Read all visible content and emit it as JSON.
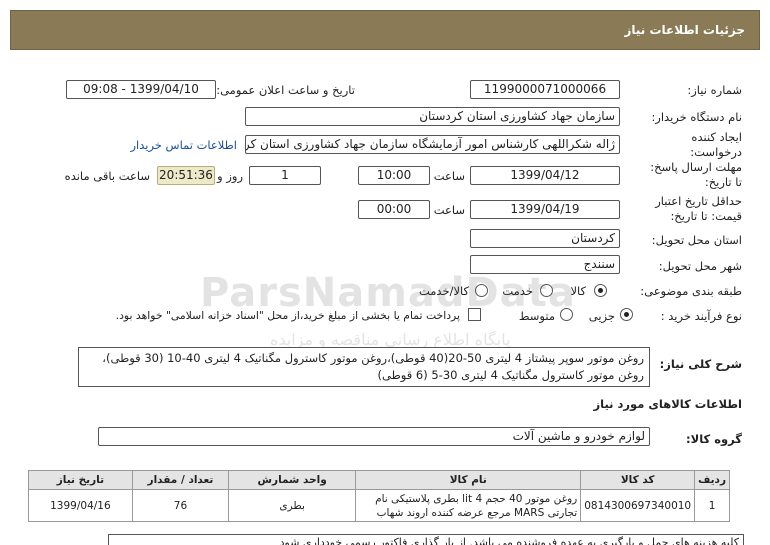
{
  "header": {
    "title": "جزئیات اطلاعات نیاز"
  },
  "form": {
    "need_number_label": "شماره نیاز:",
    "need_number": "1199000071000066",
    "announce_label": "تاریخ و ساعت اعلان عمومی:",
    "announce_value": "1399/04/10 - 09:08",
    "buyer_org_label": "نام دستگاه خریدار:",
    "buyer_org": "سازمان جهاد کشاورزی استان کردستان",
    "creator_label": "ایجاد کننده درخواست:",
    "creator": "ژاله شکراللهی کارشناس امور آزمایشگاه سازمان جهاد کشاورزی استان کردستان",
    "contact_link": "اطلاعات تماس خریدار",
    "reply_deadline_label": "مهلت ارسال پاسخ: تا تاریخ:",
    "reply_date": "1399/04/12",
    "time_label": "ساعت",
    "reply_time": "10:00",
    "days_value": "1",
    "days_label": "روز و",
    "remaining_time": "20:51:36",
    "remaining_label": "ساعت باقی مانده",
    "validity_label": "حداقل تاریخ اعتبار قیمت: تا تاریخ:",
    "validity_date": "1399/04/19",
    "validity_time": "00:00",
    "province_label": "استان محل تحویل:",
    "province": "کردستان",
    "city_label": "شهر محل تحویل:",
    "city": "سنندج",
    "category_label": "طبقه بندی موضوعی:",
    "category_options": [
      "کالا",
      "خدمت",
      "کالا/خدمت"
    ],
    "process_label": "نوع فرآیند خرید :",
    "process_options": [
      "جزیی",
      "متوسط"
    ],
    "payment_note": "پرداخت تمام یا بخشی از مبلغ خرید،از محل \"اسناد خزانه اسلامی\" خواهد بود."
  },
  "description": {
    "label": "شرح کلی نیاز:",
    "line1": "روغن موتور سوپر پیشتاز 4 لیتری 50-20(40 قوطی)،روغن موتور کاسترول مگناتیک 4 لیتری 40-10 (30 قوطی)،",
    "line2": "روغن موتور کاسترول مگناتیک 4 لیتری 30-5 (6 قوطی)"
  },
  "goods": {
    "section_title": "اطلاعات کالاهای مورد نیاز",
    "group_label": "گروه کالا:",
    "group_value": "لوازم خودرو و ماشین آلات",
    "columns": [
      "ردیف",
      "کد کالا",
      "نام کالا",
      "واحد شمارش",
      "تعداد / مقدار",
      "تاریخ نیاز"
    ],
    "rows": [
      {
        "row": "1",
        "code": "0814300697340010",
        "name": "روغن موتور 40 حجم 4 lit بطری پلاستیکی نام تجارتی MARS مرجع عرضه کننده اروند شهاب",
        "unit": "بطری",
        "qty": "76",
        "date": "1399/04/16"
      }
    ]
  },
  "bottom_text": "کلیه هزینه های حمل و بارگیری به عهده فروشنده می باشد. از بار گذاری فاکتور رسمی خودداری شود"
}
